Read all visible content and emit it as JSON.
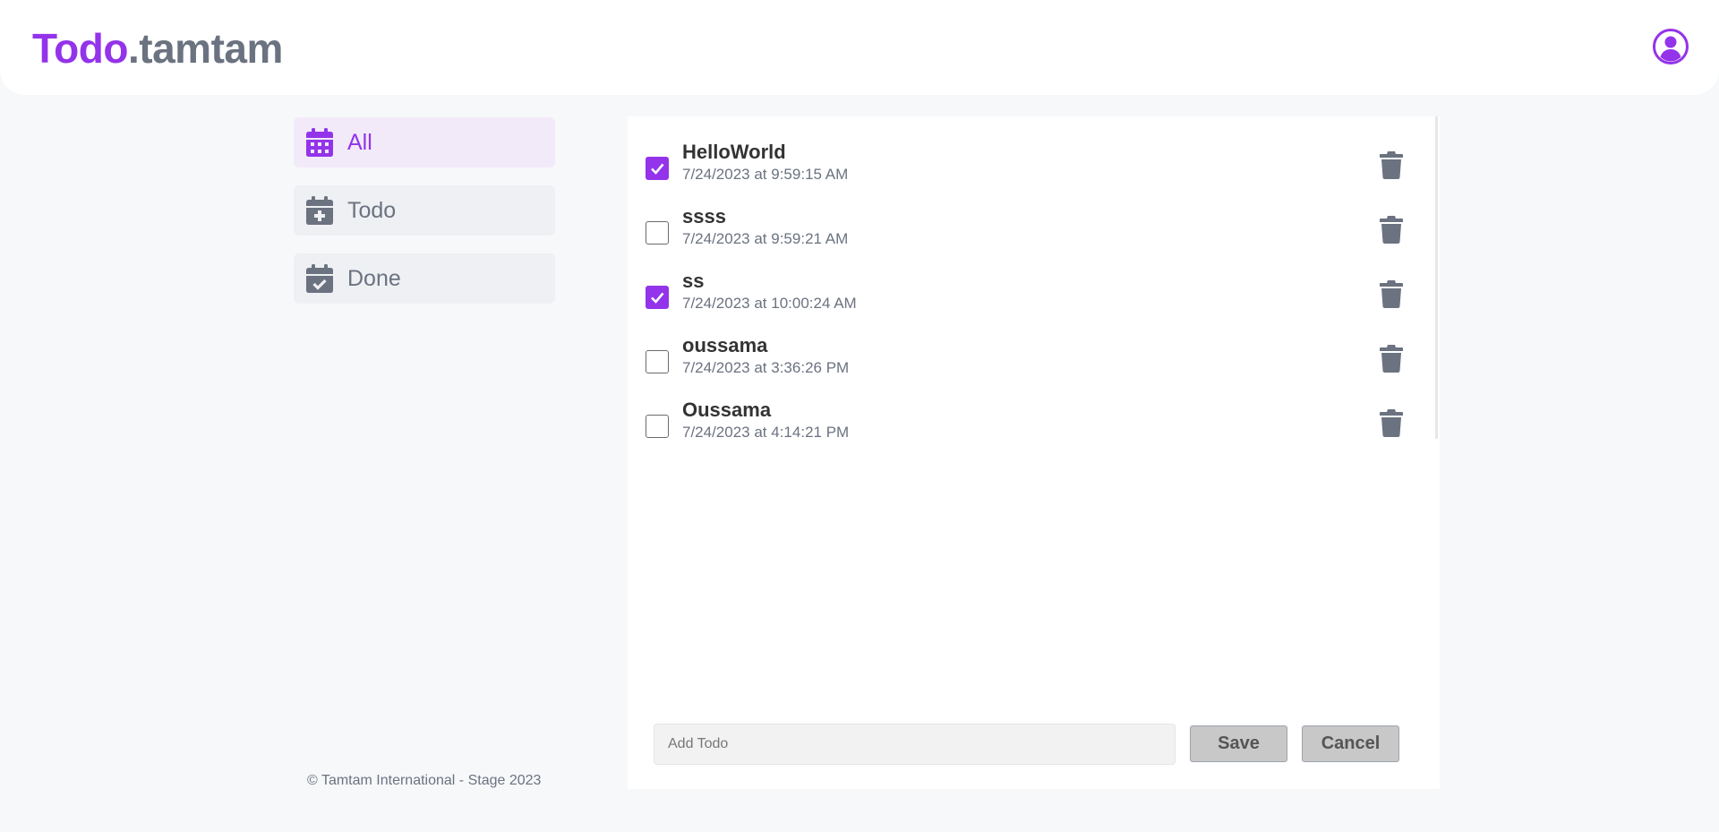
{
  "header": {
    "logo_brand": "Todo",
    "logo_suffix": ".tamtam"
  },
  "sidebar": {
    "items": [
      {
        "label": "All",
        "icon": "calendar-days-icon",
        "active": true
      },
      {
        "label": "Todo",
        "icon": "calendar-plus-icon",
        "active": false
      },
      {
        "label": "Done",
        "icon": "calendar-check-icon",
        "active": false
      }
    ]
  },
  "todos": [
    {
      "title": "HelloWorld",
      "date": "7/24/2023 at 9:59:15 AM",
      "done": true
    },
    {
      "title": "ssss",
      "date": "7/24/2023 at 9:59:21 AM",
      "done": false
    },
    {
      "title": "ss",
      "date": "7/24/2023 at 10:00:24 AM",
      "done": true
    },
    {
      "title": "oussama",
      "date": "7/24/2023 at 3:36:26 PM",
      "done": false
    },
    {
      "title": "Oussama",
      "date": "7/24/2023 at 4:14:21 PM",
      "done": false
    }
  ],
  "add_form": {
    "placeholder": "Add Todo",
    "value": "",
    "save_label": "Save",
    "cancel_label": "Cancel"
  },
  "footer": {
    "text": "© Tamtam International - Stage 2023"
  },
  "colors": {
    "accent": "#9333ea",
    "muted": "#6b7280",
    "background": "#f7f8fa"
  }
}
